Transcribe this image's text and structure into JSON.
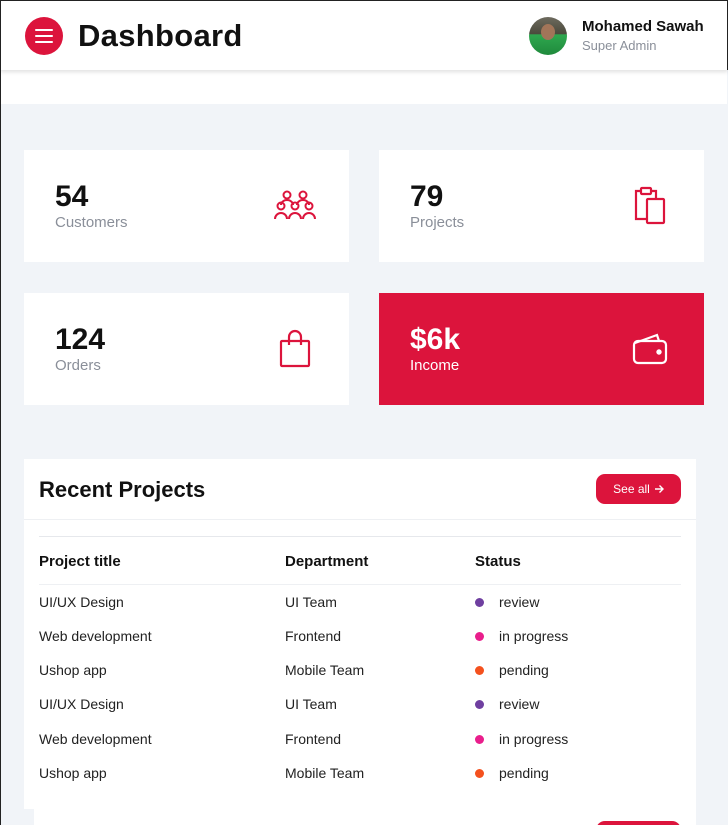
{
  "header": {
    "title": "Dashboard",
    "user_name": "Mohamed Sawah",
    "user_role": "Super Admin",
    "menu_icon": "hamburger-menu-icon"
  },
  "stats": [
    {
      "value": "54",
      "label": "Customers",
      "icon": "users-group-icon"
    },
    {
      "value": "79",
      "label": "Projects",
      "icon": "clipboard-icon"
    },
    {
      "value": "124",
      "label": "Orders",
      "icon": "shopping-bag-icon"
    },
    {
      "value": "$6k",
      "label": "Income",
      "icon": "wallet-icon"
    }
  ],
  "recent_projects": {
    "title": "Recent Projects",
    "see_all_label": "See all",
    "columns": [
      "Project title",
      "Department",
      "Status"
    ],
    "rows": [
      {
        "title": "UI/UX Design",
        "department": "UI Team",
        "status": "review",
        "status_color": "#6f3fa0"
      },
      {
        "title": "Web development",
        "department": "Frontend",
        "status": "in progress",
        "status_color": "#e91e8c"
      },
      {
        "title": "Ushop app",
        "department": "Mobile Team",
        "status": "pending",
        "status_color": "#f4511e"
      },
      {
        "title": "UI/UX Design",
        "department": "UI Team",
        "status": "review",
        "status_color": "#6f3fa0"
      },
      {
        "title": "Web development",
        "department": "Frontend",
        "status": "in progress",
        "status_color": "#e91e8c"
      },
      {
        "title": "Ushop app",
        "department": "Mobile Team",
        "status": "pending",
        "status_color": "#f4511e"
      }
    ]
  },
  "colors": {
    "accent": "#dc143c",
    "background": "#f1f4f8",
    "muted_text": "#8a8f99"
  }
}
